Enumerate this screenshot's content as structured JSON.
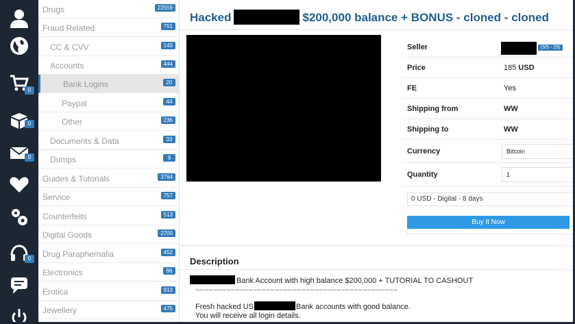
{
  "rail": {
    "items": [
      {
        "icon": "user-icon",
        "badge": ""
      },
      {
        "icon": "globe-icon",
        "badge": ""
      },
      {
        "icon": "cart-icon",
        "badge": "0"
      },
      {
        "icon": "box-icon",
        "badge": "0"
      },
      {
        "icon": "mail-icon",
        "badge": "0"
      },
      {
        "icon": "heart-icon",
        "badge": ""
      },
      {
        "icon": "gears-icon",
        "badge": ""
      },
      {
        "icon": "headset-icon",
        "badge": "0"
      },
      {
        "icon": "chat-icon",
        "badge": ""
      },
      {
        "icon": "power-icon",
        "badge": ""
      }
    ]
  },
  "categories": [
    {
      "label": "Drugs",
      "count": "22559"
    },
    {
      "label": "Fraud Related",
      "count": "751"
    },
    {
      "label": "CC & CVV",
      "count": "143"
    },
    {
      "label": "Accounts",
      "count": "444"
    },
    {
      "label": "Bank Logins",
      "count": "20"
    },
    {
      "label": "Paypal",
      "count": "44"
    },
    {
      "label": "Other",
      "count": "236"
    },
    {
      "label": "Documents & Data",
      "count": "33"
    },
    {
      "label": "Dumps",
      "count": "9"
    },
    {
      "label": "Guides & Tutorials",
      "count": "3764"
    },
    {
      "label": "Service",
      "count": "757"
    },
    {
      "label": "Counterfeits",
      "count": "513"
    },
    {
      "label": "Digital Goods",
      "count": "2700"
    },
    {
      "label": "Drug Paraphernalia",
      "count": "452"
    },
    {
      "label": "Electronics",
      "count": "86"
    },
    {
      "label": "Erotica",
      "count": "913"
    },
    {
      "label": "Jewellery",
      "count": "475"
    }
  ],
  "listing": {
    "title_prefix": "Hacked",
    "title_suffix": "$200,000 balance + BONUS - cloned - cloned",
    "seller_label": "Seller",
    "seller_rating": "(5/5 - 29)",
    "price_label": "Price",
    "price_value": "185",
    "price_currency": "USD",
    "fe_label": "FE",
    "fe_value": "Yes",
    "ship_from_label": "Shipping from",
    "ship_from_value": "WW",
    "ship_to_label": "Shipping to",
    "ship_to_value": "WW",
    "currency_label": "Currency",
    "currency_value": "Bitcoin",
    "quantity_label": "Quantity",
    "quantity_value": "1",
    "meta": "0 USD - Digital - 8 days",
    "buy_label": "Buy It Now"
  },
  "description": {
    "heading": "Description",
    "line1": "Bank Account with high balance $200,000 + TUTORIAL TO CASHOUT",
    "line2": "~~~~~~~~~~~~~~~~~~~~~~~~~~~~~~~~~~~~~~~~~~~~~~",
    "line3_prefix": "Fresh hacked US",
    "line3_suffix": "Bank accounts with good balance.",
    "line4": "You will receive all login details."
  },
  "colors": {
    "rail_bg": "#1c2733",
    "accent": "#337ab7",
    "title": "#1f5e8f",
    "buy_button": "#2e9ae6"
  }
}
